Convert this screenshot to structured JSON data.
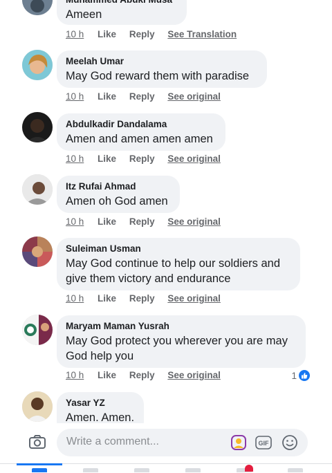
{
  "comments": [
    {
      "author": "Muhammed Abuki Musa",
      "text": "Ameen",
      "time": "10 h",
      "like": "Like",
      "reply": "Reply",
      "translation": "See Translation"
    },
    {
      "author": "Meelah Umar",
      "text": "May God reward them with paradise",
      "time": "10 h",
      "like": "Like",
      "reply": "Reply",
      "translation": "See original"
    },
    {
      "author": "Abdulkadir Dandalama",
      "text": "Amen and amen amen amen",
      "time": "10 h",
      "like": "Like",
      "reply": "Reply",
      "translation": "See original"
    },
    {
      "author": "Itz Rufai Ahmad",
      "text": "Amen oh God amen",
      "time": "10 h",
      "like": "Like",
      "reply": "Reply",
      "translation": "See original"
    },
    {
      "author": "Suleiman Usman",
      "text": "May God continue to help our soldiers and give them victory and endurance",
      "time": "10 h",
      "like": "Like",
      "reply": "Reply",
      "translation": "See original"
    },
    {
      "author": "Maryam Maman Yusrah",
      "text": "May God protect you wherever you are may God help you",
      "time": "10 h",
      "like": "Like",
      "reply": "Reply",
      "translation": "See original",
      "reactions": "1"
    },
    {
      "author": "Yasar YZ",
      "text": "Amen. Amen."
    }
  ],
  "composer": {
    "placeholder": "Write a comment...",
    "gif_label": "GIF"
  },
  "colors": {
    "accent": "#1877f2",
    "bubble": "#f0f2f5",
    "meta": "#65676b"
  }
}
